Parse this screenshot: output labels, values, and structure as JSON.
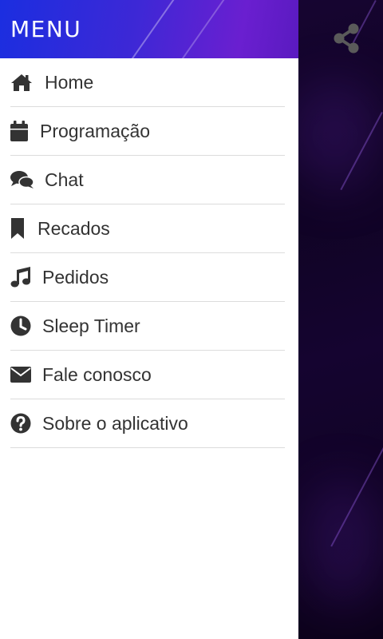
{
  "drawer": {
    "title": "MENU",
    "items": [
      {
        "label": "Home",
        "icon": "home-icon"
      },
      {
        "label": "Programação",
        "icon": "calendar-icon"
      },
      {
        "label": "Chat",
        "icon": "chat-icon"
      },
      {
        "label": "Recados",
        "icon": "bookmark-icon"
      },
      {
        "label": "Pedidos",
        "icon": "music-note-icon"
      },
      {
        "label": "Sleep Timer",
        "icon": "clock-icon"
      },
      {
        "label": "Fale conosco",
        "icon": "envelope-icon"
      },
      {
        "label": "Sobre o aplicativo",
        "icon": "question-circle-icon"
      }
    ]
  },
  "toolbar": {
    "share_icon": "share-icon"
  },
  "colors": {
    "header_gradient_start": "#1b2ee0",
    "header_gradient_end": "#6a1fd0",
    "icon_color": "#333333",
    "background": "#0f0322",
    "share_icon_color": "#5a5a5a"
  }
}
